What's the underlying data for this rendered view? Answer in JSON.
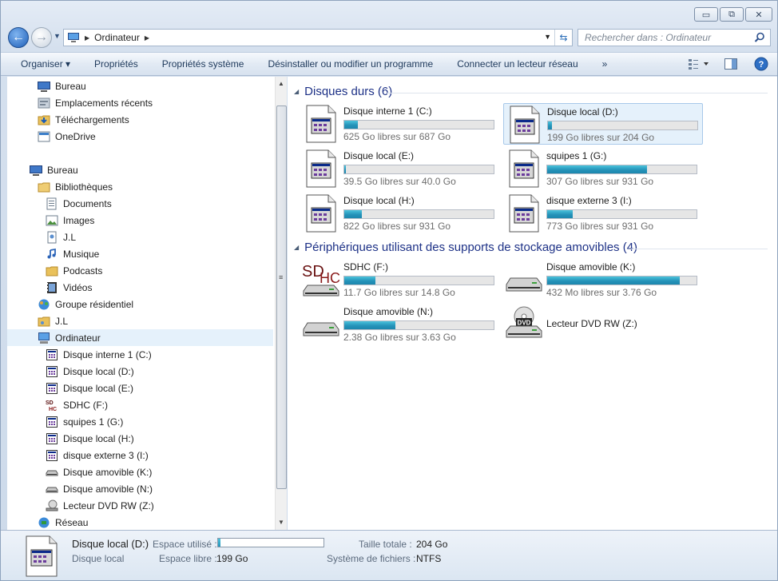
{
  "window": {
    "minimize_glyph": "▭",
    "maximize_glyph": "⧉",
    "close_glyph": "✕"
  },
  "address": {
    "crumb": "Ordinateur",
    "search_placeholder": "Rechercher dans : Ordinateur"
  },
  "toolbar": {
    "items": [
      "Organiser ▾",
      "Propriétés",
      "Propriétés système",
      "Désinstaller ou modifier un programme",
      "Connecter un lecteur réseau",
      "»"
    ]
  },
  "nav": {
    "items": [
      {
        "label": "Bureau",
        "icon": "desktop-icon",
        "indent": 1
      },
      {
        "label": "Emplacements récents",
        "icon": "recent-places-icon",
        "indent": 1
      },
      {
        "label": "Téléchargements",
        "icon": "downloads-folder-icon",
        "indent": 1
      },
      {
        "label": "OneDrive",
        "icon": "onedrive-icon",
        "indent": 1
      },
      {
        "label": "Bureau",
        "icon": "desktop-icon",
        "indent": 0,
        "gap": true
      },
      {
        "label": "Bibliothèques",
        "icon": "libraries-icon",
        "indent": 1
      },
      {
        "label": "Documents",
        "icon": "documents-icon",
        "indent": 2
      },
      {
        "label": "Images",
        "icon": "images-icon",
        "indent": 2
      },
      {
        "label": "J.L",
        "icon": "user-library-icon",
        "indent": 2
      },
      {
        "label": "Musique",
        "icon": "music-icon",
        "indent": 2
      },
      {
        "label": "Podcasts",
        "icon": "podcasts-folder-icon",
        "indent": 2
      },
      {
        "label": "Vidéos",
        "icon": "videos-icon",
        "indent": 2
      },
      {
        "label": "Groupe résidentiel",
        "icon": "homegroup-icon",
        "indent": 1
      },
      {
        "label": "J.L",
        "icon": "user-folder-icon",
        "indent": 1
      },
      {
        "label": "Ordinateur",
        "icon": "computer-icon",
        "indent": 1,
        "selected": true
      },
      {
        "label": "Disque interne 1 (C:)",
        "icon": "drive-icon",
        "indent": 2
      },
      {
        "label": "Disque local (D:)",
        "icon": "drive-icon",
        "indent": 2
      },
      {
        "label": "Disque local (E:)",
        "icon": "drive-icon",
        "indent": 2
      },
      {
        "label": "SDHC (F:)",
        "icon": "sdhc-icon",
        "indent": 2
      },
      {
        "label": "squipes 1 (G:)",
        "icon": "drive-icon",
        "indent": 2
      },
      {
        "label": "Disque local (H:)",
        "icon": "drive-icon",
        "indent": 2
      },
      {
        "label": "disque externe 3 (I:)",
        "icon": "drive-icon",
        "indent": 2
      },
      {
        "label": "Disque amovible (K:)",
        "icon": "removable-drive-icon",
        "indent": 2
      },
      {
        "label": "Disque amovible (N:)",
        "icon": "removable-drive-icon",
        "indent": 2
      },
      {
        "label": "Lecteur DVD RW (Z:)",
        "icon": "dvd-drive-icon",
        "indent": 2
      },
      {
        "label": "Réseau",
        "icon": "network-icon",
        "indent": 1
      }
    ]
  },
  "groups": [
    {
      "title": "Disques durs (6)"
    },
    {
      "title": "Périphériques utilisant des supports de stockage amovibles (4)"
    }
  ],
  "drives": [
    {
      "name": "Disque interne 1 (C:)",
      "free": "625 Go libres sur 687 Go",
      "used_fraction": 0.09,
      "icon": "hard-drive-icon",
      "group": 0,
      "col": 0,
      "row": 0
    },
    {
      "name": "Disque local (D:)",
      "free": "199 Go libres sur 204 Go",
      "used_fraction": 0.025,
      "icon": "hard-drive-icon",
      "group": 0,
      "col": 1,
      "row": 0,
      "selected": true
    },
    {
      "name": "Disque local (E:)",
      "free": "39.5 Go libres sur 40.0 Go",
      "used_fraction": 0.0125,
      "icon": "hard-drive-icon",
      "group": 0,
      "col": 0,
      "row": 1
    },
    {
      "name": "squipes 1 (G:)",
      "free": "307 Go libres sur 931 Go",
      "used_fraction": 0.67,
      "icon": "hard-drive-icon",
      "group": 0,
      "col": 1,
      "row": 1
    },
    {
      "name": "Disque local (H:)",
      "free": "822 Go libres sur 931 Go",
      "used_fraction": 0.117,
      "icon": "hard-drive-icon",
      "group": 0,
      "col": 0,
      "row": 2
    },
    {
      "name": "disque externe 3 (I:)",
      "free": "773 Go libres sur 931 Go",
      "used_fraction": 0.17,
      "icon": "hard-drive-icon",
      "group": 0,
      "col": 1,
      "row": 2
    },
    {
      "name": "SDHC (F:)",
      "free": "11.7 Go libres sur 14.8 Go",
      "used_fraction": 0.21,
      "icon": "sdhc-card-icon",
      "group": 1,
      "col": 0,
      "row": 0
    },
    {
      "name": "Disque amovible (K:)",
      "free": "432 Mo libres sur 3.76 Go",
      "used_fraction": 0.89,
      "icon": "removable-drive-icon",
      "group": 1,
      "col": 1,
      "row": 0
    },
    {
      "name": "Disque amovible (N:)",
      "free": "2.38 Go libres sur 3.63 Go",
      "used_fraction": 0.34,
      "icon": "removable-drive-icon",
      "group": 1,
      "col": 0,
      "row": 1
    },
    {
      "name": "Lecteur DVD RW (Z:)",
      "free": "",
      "used_fraction": null,
      "icon": "dvd-drive-icon",
      "group": 1,
      "col": 1,
      "row": 1
    }
  ],
  "details": {
    "name": "Disque local (D:)",
    "type": "Disque local",
    "used_label": "Espace utilisé :",
    "used_fraction": 0.025,
    "free_label": "Espace libre :",
    "free_value": "199 Go",
    "total_label": "Taille totale :",
    "total_value": "204 Go",
    "fs_label": "Système de fichiers :",
    "fs_value": "NTFS"
  },
  "colors": {
    "accent": "#1e3287",
    "bar_fill": "#2593b9",
    "selection": "#e5f1fb"
  }
}
